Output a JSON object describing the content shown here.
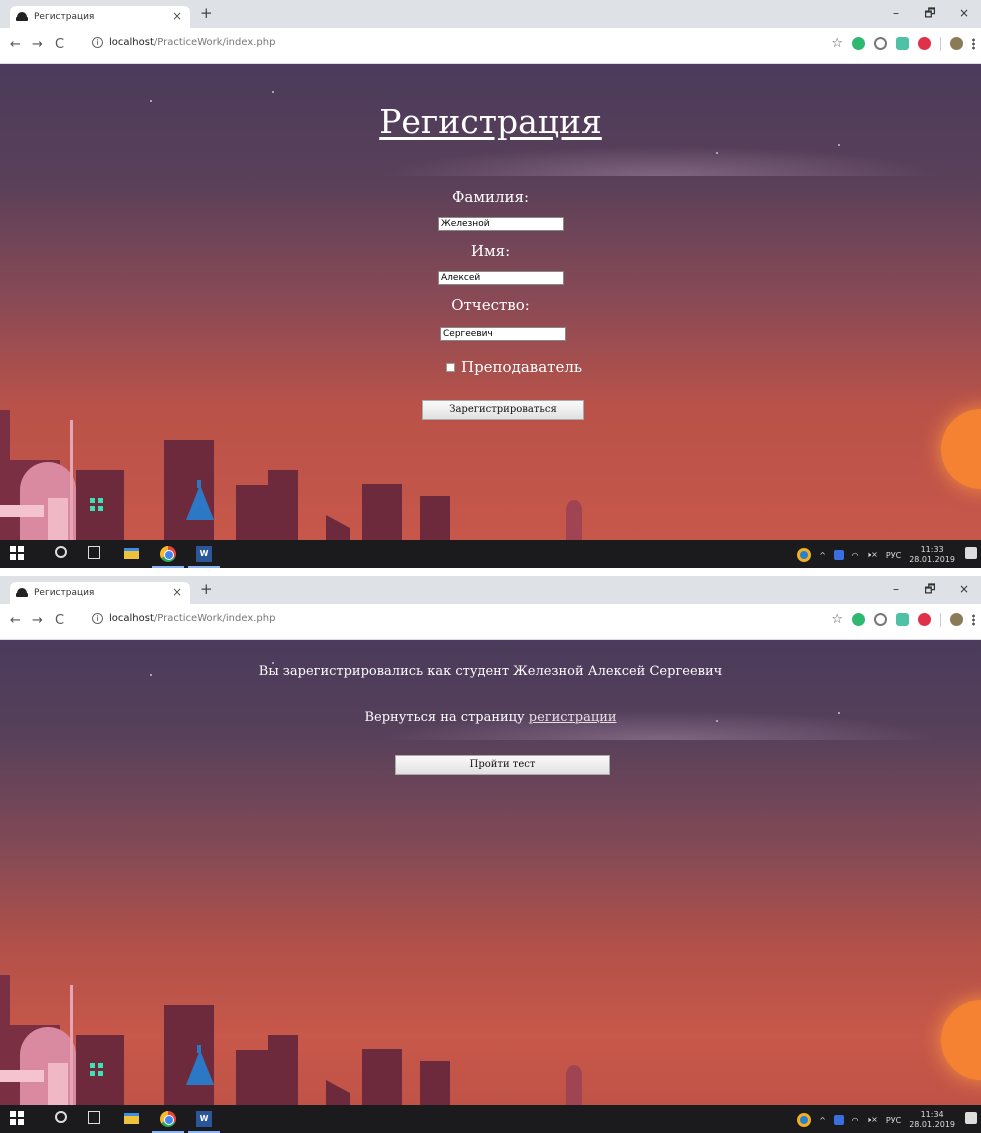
{
  "browser": {
    "tab_title": "Регистрация",
    "tab_close": "×",
    "new_tab": "+",
    "window_buttons": [
      "–",
      "🗗",
      "×"
    ],
    "nav": {
      "back": "←",
      "forward": "→",
      "reload": "C"
    },
    "url_host": "localhost",
    "url_path": "/PracticeWork/index.php",
    "bookmark_star": "☆"
  },
  "screen1": {
    "title": "Регистрация",
    "fields": [
      {
        "label": "Фамилия:",
        "value": "Железной"
      },
      {
        "label": "Имя:",
        "value": "Алексей"
      },
      {
        "label": "Отчество:",
        "value": "Сергеевич"
      }
    ],
    "checkbox_label": "Преподаватель",
    "submit_label": "Зарегистрироваться",
    "taskbar": {
      "time": "11:33",
      "date": "28.01.2019"
    }
  },
  "screen2": {
    "message": "Вы зарегистрировались как студент Железной Алексей Сергеевич",
    "back_text": "Вернуться на страницу ",
    "back_link": "регистрации",
    "test_button": "Пройти тест",
    "taskbar": {
      "time": "11:34",
      "date": "28.01.2019"
    }
  },
  "tray": {
    "language": "РУС",
    "volume": "🕨×"
  },
  "colors": {
    "sun": "#f58232",
    "taskbar": "#1b1b1d",
    "sky_top": "#4b3b5c",
    "sky_bottom": "#c7574a"
  }
}
